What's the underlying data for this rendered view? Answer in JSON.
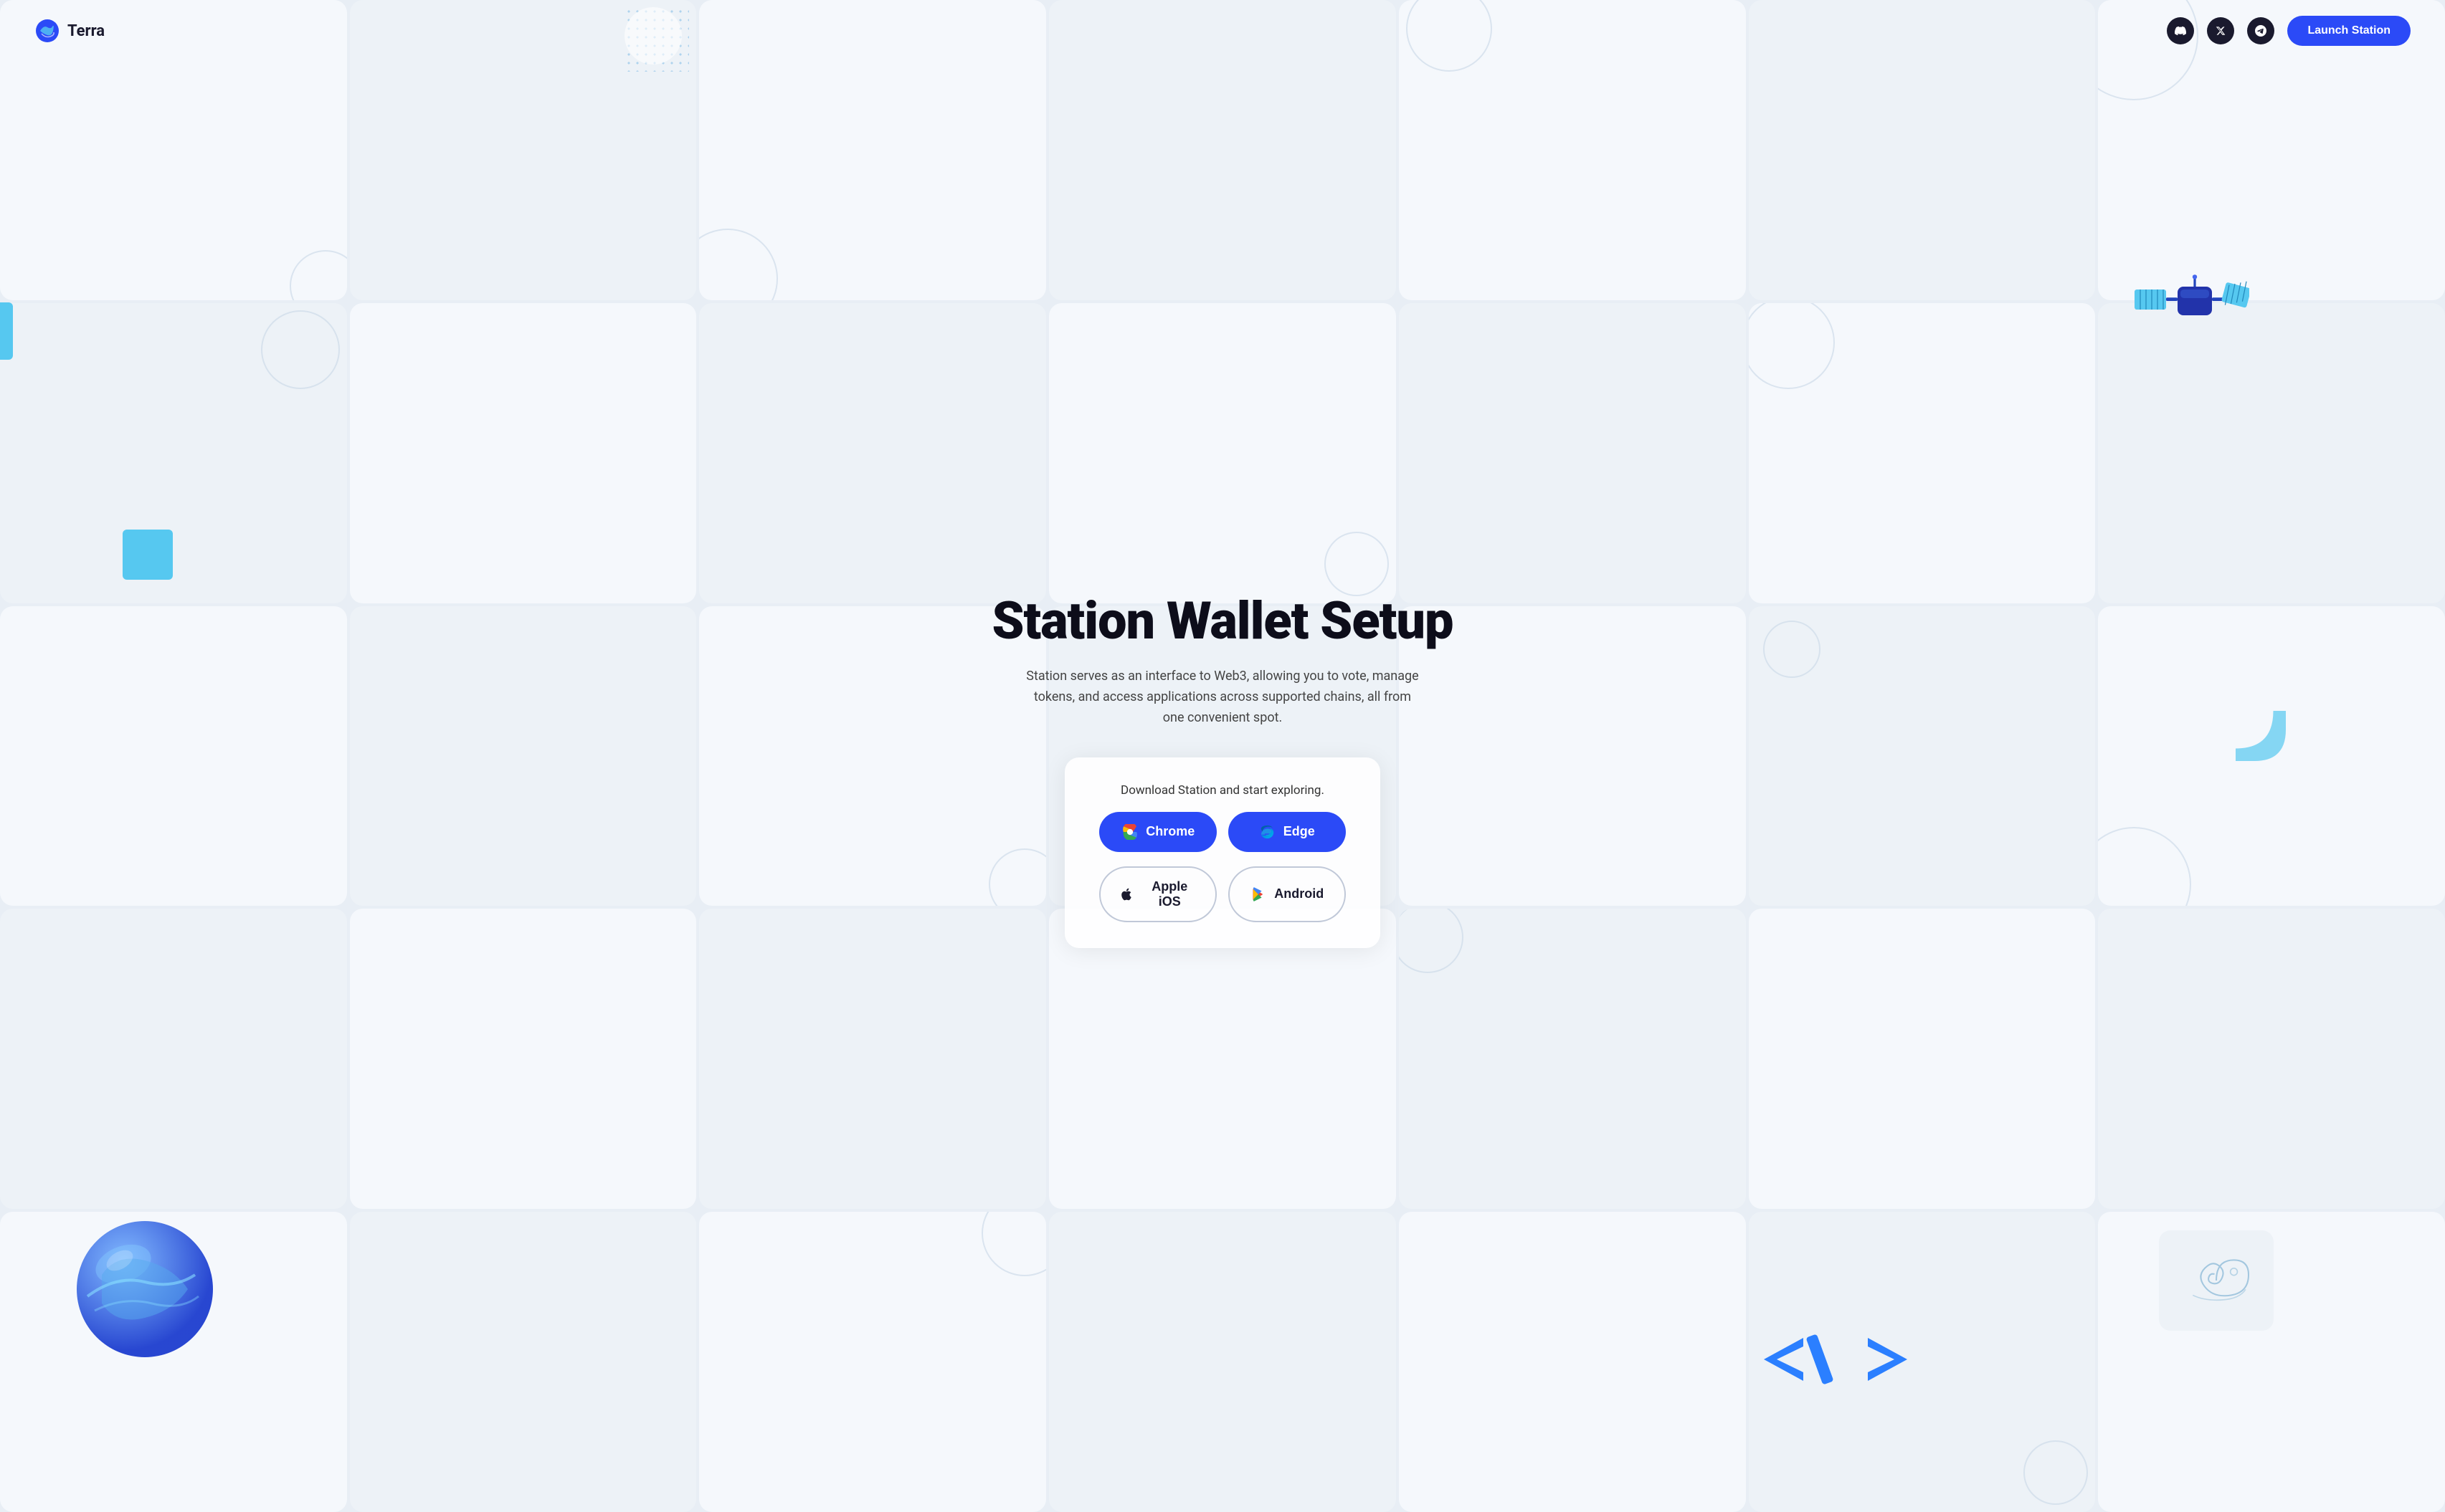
{
  "logo": {
    "name": "Terra",
    "label": "Terra"
  },
  "navbar": {
    "launch_label": "Launch Station"
  },
  "hero": {
    "title": "Station Wallet Setup",
    "subtitle": "Station serves as an interface to Web3, allowing you to vote, manage tokens, and access applications across supported chains, all from one convenient spot."
  },
  "download": {
    "label": "Download Station and start exploring.",
    "chrome_label": "Chrome",
    "edge_label": "Edge",
    "ios_label": "Apple iOS",
    "android_label": "Android"
  },
  "icons": {
    "discord": "🎮",
    "x": "✕",
    "telegram": "✈"
  },
  "colors": {
    "primary": "#2b4af7",
    "dark": "#1a1a2e",
    "accent_blue": "#56c8f0"
  }
}
